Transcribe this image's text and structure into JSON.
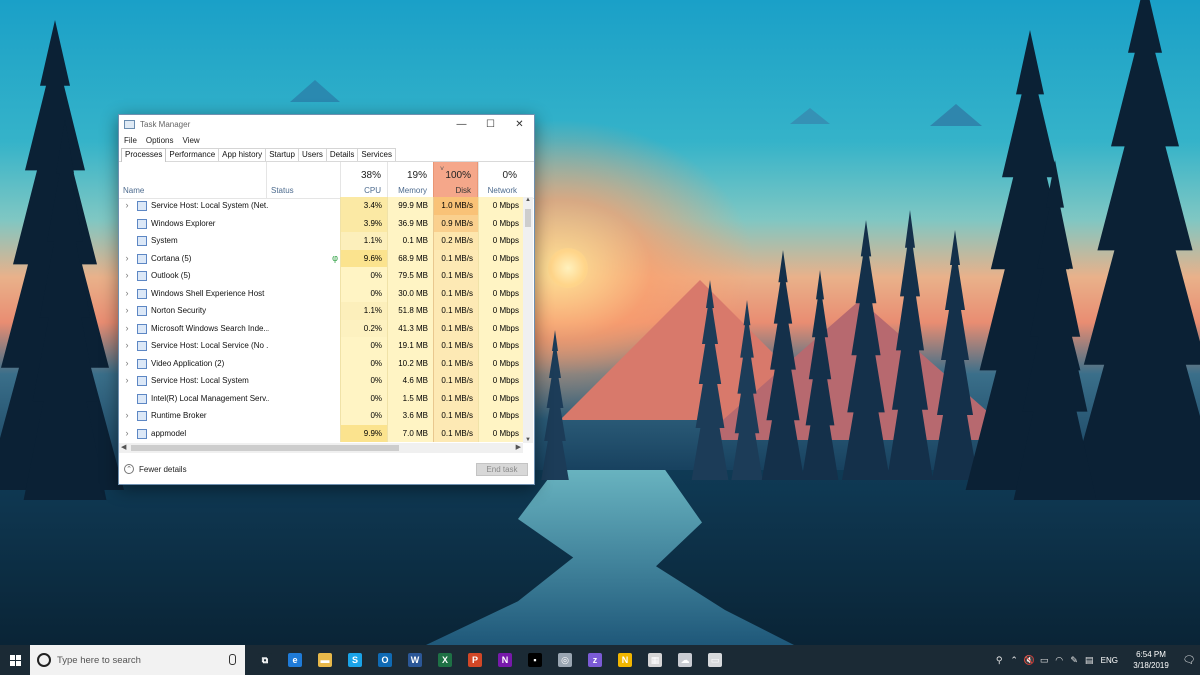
{
  "window": {
    "title": "Task Manager",
    "controls": {
      "minimize": "—",
      "maximize": "☐",
      "close": "✕"
    }
  },
  "menu": [
    "File",
    "Options",
    "View"
  ],
  "tabs": [
    "Processes",
    "Performance",
    "App history",
    "Startup",
    "Users",
    "Details",
    "Services"
  ],
  "active_tab": "Processes",
  "columns": {
    "name": {
      "label": "Name"
    },
    "status": {
      "label": "Status"
    },
    "cpu": {
      "label": "CPU",
      "total": "38%"
    },
    "memory": {
      "label": "Memory",
      "total": "19%"
    },
    "disk": {
      "label": "Disk",
      "total": "100%",
      "sort_arrow": "˅"
    },
    "network": {
      "label": "Network",
      "total": "0%"
    }
  },
  "processes": [
    {
      "expand": "›",
      "name": "Service Host: Local System (Net...",
      "status": "",
      "cpu": "3.4%",
      "memory": "99.9 MB",
      "disk": "1.0 MB/s",
      "network": "0 Mbps",
      "cpu_bg": "#fbe9a4",
      "disk_bg": "#f9c277"
    },
    {
      "expand": "",
      "name": "Windows Explorer",
      "status": "",
      "cpu": "3.9%",
      "memory": "36.9 MB",
      "disk": "0.9 MB/s",
      "network": "0 Mbps",
      "cpu_bg": "#fbe9a4",
      "disk_bg": "#fad08e"
    },
    {
      "expand": "",
      "name": "System",
      "status": "",
      "cpu": "1.1%",
      "memory": "0.1 MB",
      "disk": "0.2 MB/s",
      "network": "0 Mbps",
      "cpu_bg": "#fcefbb",
      "disk_bg": "#fde6ad"
    },
    {
      "expand": "›",
      "name": "Cortana (5)",
      "status": "φ",
      "cpu": "9.6%",
      "memory": "68.9 MB",
      "disk": "0.1 MB/s",
      "network": "0 Mbps",
      "cpu_bg": "#fbe38e",
      "disk_bg": "#fde9b4"
    },
    {
      "expand": "›",
      "name": "Outlook (5)",
      "status": "",
      "cpu": "0%",
      "memory": "79.5 MB",
      "disk": "0.1 MB/s",
      "network": "0 Mbps",
      "cpu_bg": "#fff4c4",
      "disk_bg": "#fde9b4"
    },
    {
      "expand": "›",
      "name": "Windows Shell Experience Host",
      "status": "",
      "cpu": "0%",
      "memory": "30.0 MB",
      "disk": "0.1 MB/s",
      "network": "0 Mbps",
      "cpu_bg": "#fff4c4",
      "disk_bg": "#fde9b4"
    },
    {
      "expand": "›",
      "name": "Norton Security",
      "status": "",
      "cpu": "1.1%",
      "memory": "51.8 MB",
      "disk": "0.1 MB/s",
      "network": "0 Mbps",
      "cpu_bg": "#fcefbb",
      "disk_bg": "#fde9b4"
    },
    {
      "expand": "›",
      "name": "Microsoft Windows Search Inde...",
      "status": "",
      "cpu": "0.2%",
      "memory": "41.3 MB",
      "disk": "0.1 MB/s",
      "network": "0 Mbps",
      "cpu_bg": "#fdf1c0",
      "disk_bg": "#fde9b4"
    },
    {
      "expand": "›",
      "name": "Service Host: Local Service (No ...",
      "status": "",
      "cpu": "0%",
      "memory": "19.1 MB",
      "disk": "0.1 MB/s",
      "network": "0 Mbps",
      "cpu_bg": "#fff4c4",
      "disk_bg": "#fde9b4"
    },
    {
      "expand": "›",
      "name": "Video Application (2)",
      "status": "",
      "cpu": "0%",
      "memory": "10.2 MB",
      "disk": "0.1 MB/s",
      "network": "0 Mbps",
      "cpu_bg": "#fff4c4",
      "disk_bg": "#fde9b4"
    },
    {
      "expand": "›",
      "name": "Service Host: Local System",
      "status": "",
      "cpu": "0%",
      "memory": "4.6 MB",
      "disk": "0.1 MB/s",
      "network": "0 Mbps",
      "cpu_bg": "#fff4c4",
      "disk_bg": "#fde9b4"
    },
    {
      "expand": "",
      "name": "Intel(R) Local Management Serv...",
      "status": "",
      "cpu": "0%",
      "memory": "1.5 MB",
      "disk": "0.1 MB/s",
      "network": "0 Mbps",
      "cpu_bg": "#fff4c4",
      "disk_bg": "#fde9b4"
    },
    {
      "expand": "›",
      "name": "Runtime Broker",
      "status": "",
      "cpu": "0%",
      "memory": "3.6 MB",
      "disk": "0.1 MB/s",
      "network": "0 Mbps",
      "cpu_bg": "#fff4c4",
      "disk_bg": "#fde9b4"
    },
    {
      "expand": "›",
      "name": "appmodel",
      "status": "",
      "cpu": "9.9%",
      "memory": "7.0 MB",
      "disk": "0.1 MB/s",
      "network": "0 Mbps",
      "cpu_bg": "#fbe38e",
      "disk_bg": "#fde9b4"
    }
  ],
  "footer": {
    "fewer_details": "Fewer details",
    "end_task": "End task"
  },
  "taskbar": {
    "search_placeholder": "Type here to search",
    "apps": [
      {
        "icon": "task-view-icon",
        "glyph": "⧉",
        "color": "#1b2a35"
      },
      {
        "icon": "edge-icon",
        "glyph": "e",
        "color": "#1f7bd8"
      },
      {
        "icon": "file-explorer-icon",
        "glyph": "▬",
        "color": "#e8b84a"
      },
      {
        "icon": "skype-icon",
        "glyph": "S",
        "color": "#1aa3e8"
      },
      {
        "icon": "outlook-icon",
        "glyph": "O",
        "color": "#0f6ab4"
      },
      {
        "icon": "word-icon",
        "glyph": "W",
        "color": "#2b5797"
      },
      {
        "icon": "excel-icon",
        "glyph": "X",
        "color": "#1e7145"
      },
      {
        "icon": "powerpoint-icon",
        "glyph": "P",
        "color": "#d24726"
      },
      {
        "icon": "onenote-icon",
        "glyph": "N",
        "color": "#7719aa"
      },
      {
        "icon": "terminal-icon",
        "glyph": "▪",
        "color": "#000000"
      },
      {
        "icon": "globe-app-icon",
        "glyph": "◎",
        "color": "#9aa6b2"
      },
      {
        "icon": "zune-app-icon",
        "glyph": "z",
        "color": "#7b5bd6"
      },
      {
        "icon": "norton-icon",
        "glyph": "N",
        "color": "#f2b600"
      },
      {
        "icon": "calculator-icon",
        "glyph": "▦",
        "color": "#d5d5d5"
      },
      {
        "icon": "cloud-app-icon",
        "glyph": "☁",
        "color": "#c9ccd2"
      },
      {
        "icon": "device-app-icon",
        "glyph": "▭",
        "color": "#d7d9dc"
      }
    ],
    "tray": {
      "language": "ENG",
      "time": "6:54 PM",
      "date": "3/18/2019"
    }
  }
}
